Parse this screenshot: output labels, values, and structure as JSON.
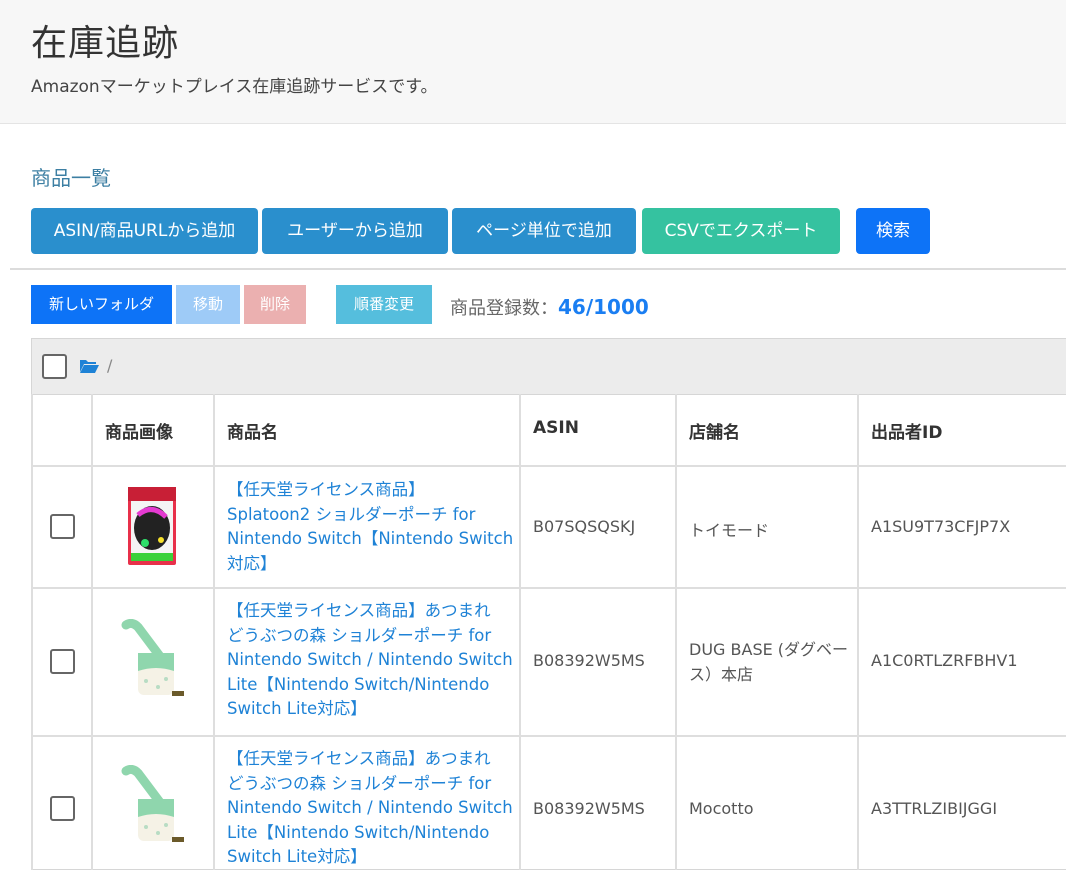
{
  "header": {
    "title": "在庫追跡",
    "subtitle": "Amazonマーケットプレイス在庫追跡サービスです。"
  },
  "section": {
    "title": "商品一覧"
  },
  "toolbar": {
    "add_asin": "ASIN/商品URLから追加",
    "add_user": "ユーザーから追加",
    "add_page": "ページ単位で追加",
    "export_csv": "CSVでエクスポート",
    "search": "検索"
  },
  "folder_bar": {
    "new_folder": "新しいフォルダ",
    "move": "移動",
    "delete": "削除",
    "reorder": "順番変更",
    "count_label": "商品登録数：",
    "count_value": "46/1000"
  },
  "breadcrumb": {
    "path": "/"
  },
  "table": {
    "headers": {
      "image": "商品画像",
      "name": "商品名",
      "asin": "ASIN",
      "shop": "店舗名",
      "seller": "出品者ID"
    },
    "rows": [
      {
        "name_lines": [
          "【任天堂ライセンス商品】",
          "Splatoon2 ショルダーポーチ for",
          "Nintendo Switch【Nintendo Switch",
          "対応】"
        ],
        "asin": "B07SQSQSKJ",
        "shop_lines": [
          "トイモード"
        ],
        "seller": "A1SU9T73CFJP7X",
        "image_icon": "splatoon-pouch-product-image"
      },
      {
        "name_lines": [
          "【任天堂ライセンス商品】あつまれ",
          "どうぶつの森 ショルダーポーチ for",
          "Nintendo Switch / Nintendo Switch",
          "Lite【Nintendo Switch/Nintendo",
          "Switch Lite対応】"
        ],
        "asin": "B08392W5MS",
        "shop_lines": [
          "DUG BASE (ダグベー",
          "ス）本店"
        ],
        "seller": "A1C0RTLZRFBHV1",
        "image_icon": "animal-crossing-pouch-product-image"
      },
      {
        "name_lines": [
          "【任天堂ライセンス商品】あつまれ",
          "どうぶつの森 ショルダーポーチ for",
          "Nintendo Switch / Nintendo Switch",
          "Lite【Nintendo Switch/Nintendo",
          "Switch Lite対応】"
        ],
        "asin": "B08392W5MS",
        "shop_lines": [
          "Mocotto"
        ],
        "seller": "A3TTRLZIBIJGGI",
        "image_icon": "animal-crossing-pouch-product-image"
      }
    ]
  },
  "colors": {
    "primary": "#2a8fcd",
    "csv": "#35c2a0",
    "search": "#0d73f7",
    "link": "#1e82d6"
  }
}
